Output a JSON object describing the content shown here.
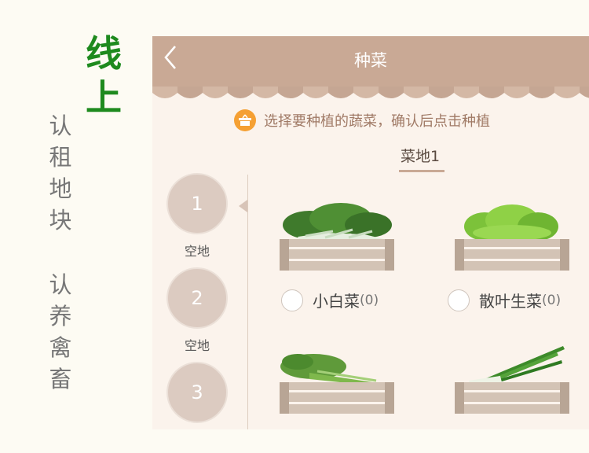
{
  "side_heading": {
    "line1": "线",
    "line2": "上"
  },
  "side_text_a": [
    "认",
    "租",
    "地",
    "块"
  ],
  "side_text_b": [
    "认",
    "养",
    "禽",
    "畜"
  ],
  "navbar": {
    "back_icon": "‹",
    "title": "种菜"
  },
  "tip": {
    "text": "选择要种植的蔬菜，确认后点击种植",
    "icon": "basket-icon"
  },
  "tab": {
    "label": "菜地1"
  },
  "plots": [
    {
      "number": "1",
      "status": "空地"
    },
    {
      "number": "2",
      "status": "空地"
    },
    {
      "number": "3",
      "status": ""
    }
  ],
  "vegetables": [
    {
      "name": "小白菜",
      "count": "(0)",
      "icon": "bok-choy"
    },
    {
      "name": "散叶生菜",
      "count": "(0)",
      "icon": "leaf-lettuce"
    },
    {
      "name": "",
      "count": "",
      "icon": "celery"
    },
    {
      "name": "",
      "count": "",
      "icon": "green-onion"
    }
  ],
  "colors": {
    "brand_green": "#1e8a1e",
    "navbar": "#c9a995",
    "tip_icon": "#f5a033",
    "crate": "#d3c3b5"
  }
}
